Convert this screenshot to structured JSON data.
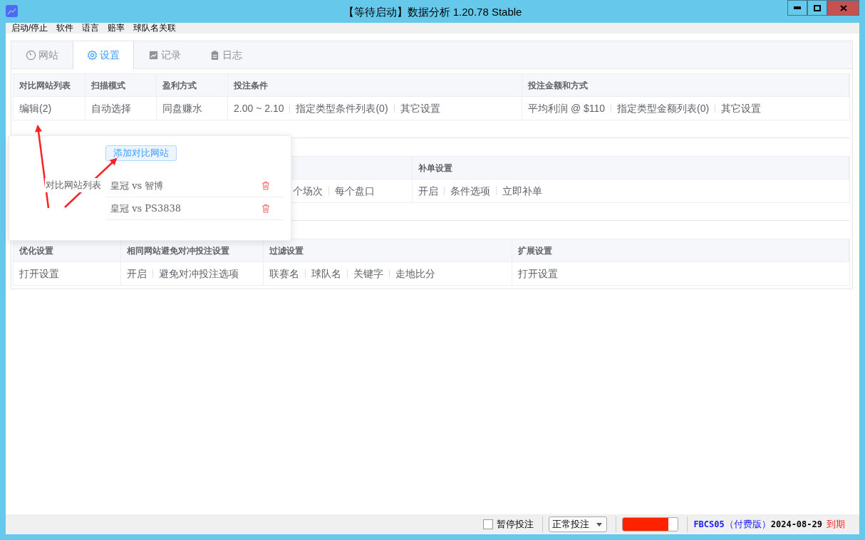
{
  "window": {
    "title": "【等待启动】数据分析 1.20.78 Stable"
  },
  "menu": [
    "启动/停止",
    "软件",
    "语言",
    "赔率",
    "球队名关联"
  ],
  "tabs": [
    {
      "label": "网站",
      "selected": false
    },
    {
      "label": "设置",
      "selected": true
    },
    {
      "label": "记录",
      "selected": false
    },
    {
      "label": "日志",
      "selected": false
    }
  ],
  "sections": [
    {
      "columns": [
        {
          "header": "对比网站列表",
          "items": [
            "编辑(2)"
          ]
        },
        {
          "header": "扫描模式",
          "items": [
            "自动选择"
          ]
        },
        {
          "header": "盈利方式",
          "items": [
            "同盘赚水"
          ]
        },
        {
          "header": "投注条件",
          "items": [
            "2.00 ~ 2.10",
            "指定类型条件列表(0)",
            "其它设置"
          ]
        },
        {
          "header": "投注金额和方式",
          "items": [
            "平均利润 @ $110",
            "指定类型金额列表(0)",
            "其它设置"
          ]
        }
      ]
    },
    {
      "columns": [
        {
          "items": [
            "个场次",
            "每个盘口"
          ]
        },
        {
          "header": "补单设置",
          "items": [
            "开启",
            "条件选项",
            "立即补单"
          ]
        }
      ]
    },
    {
      "columns": [
        {
          "header": "优化设置",
          "items": [
            "打开设置"
          ]
        },
        {
          "header": "相同网站避免对冲投注设置",
          "items": [
            "开启",
            "避免对冲投注选项"
          ]
        },
        {
          "header": "过滤设置",
          "items": [
            "联赛名",
            "球队名",
            "关键字",
            "走地比分"
          ]
        },
        {
          "header": "扩展设置",
          "items": [
            "打开设置"
          ]
        }
      ]
    }
  ],
  "popup": {
    "button": "添加对比网站",
    "label": "对比网站列表",
    "sites": [
      "皇冠 vs 智博",
      "皇冠 vs PS3838"
    ]
  },
  "status_bar": {
    "pause": {
      "label": "暂停投注",
      "checked": false
    },
    "mode": {
      "value": "正常投注"
    },
    "progress": {
      "level": 0.83
    },
    "license": {
      "code": "FBCS05",
      "edition": "（付费版）",
      "date": "2024-08-29",
      "status": "到期"
    }
  }
}
